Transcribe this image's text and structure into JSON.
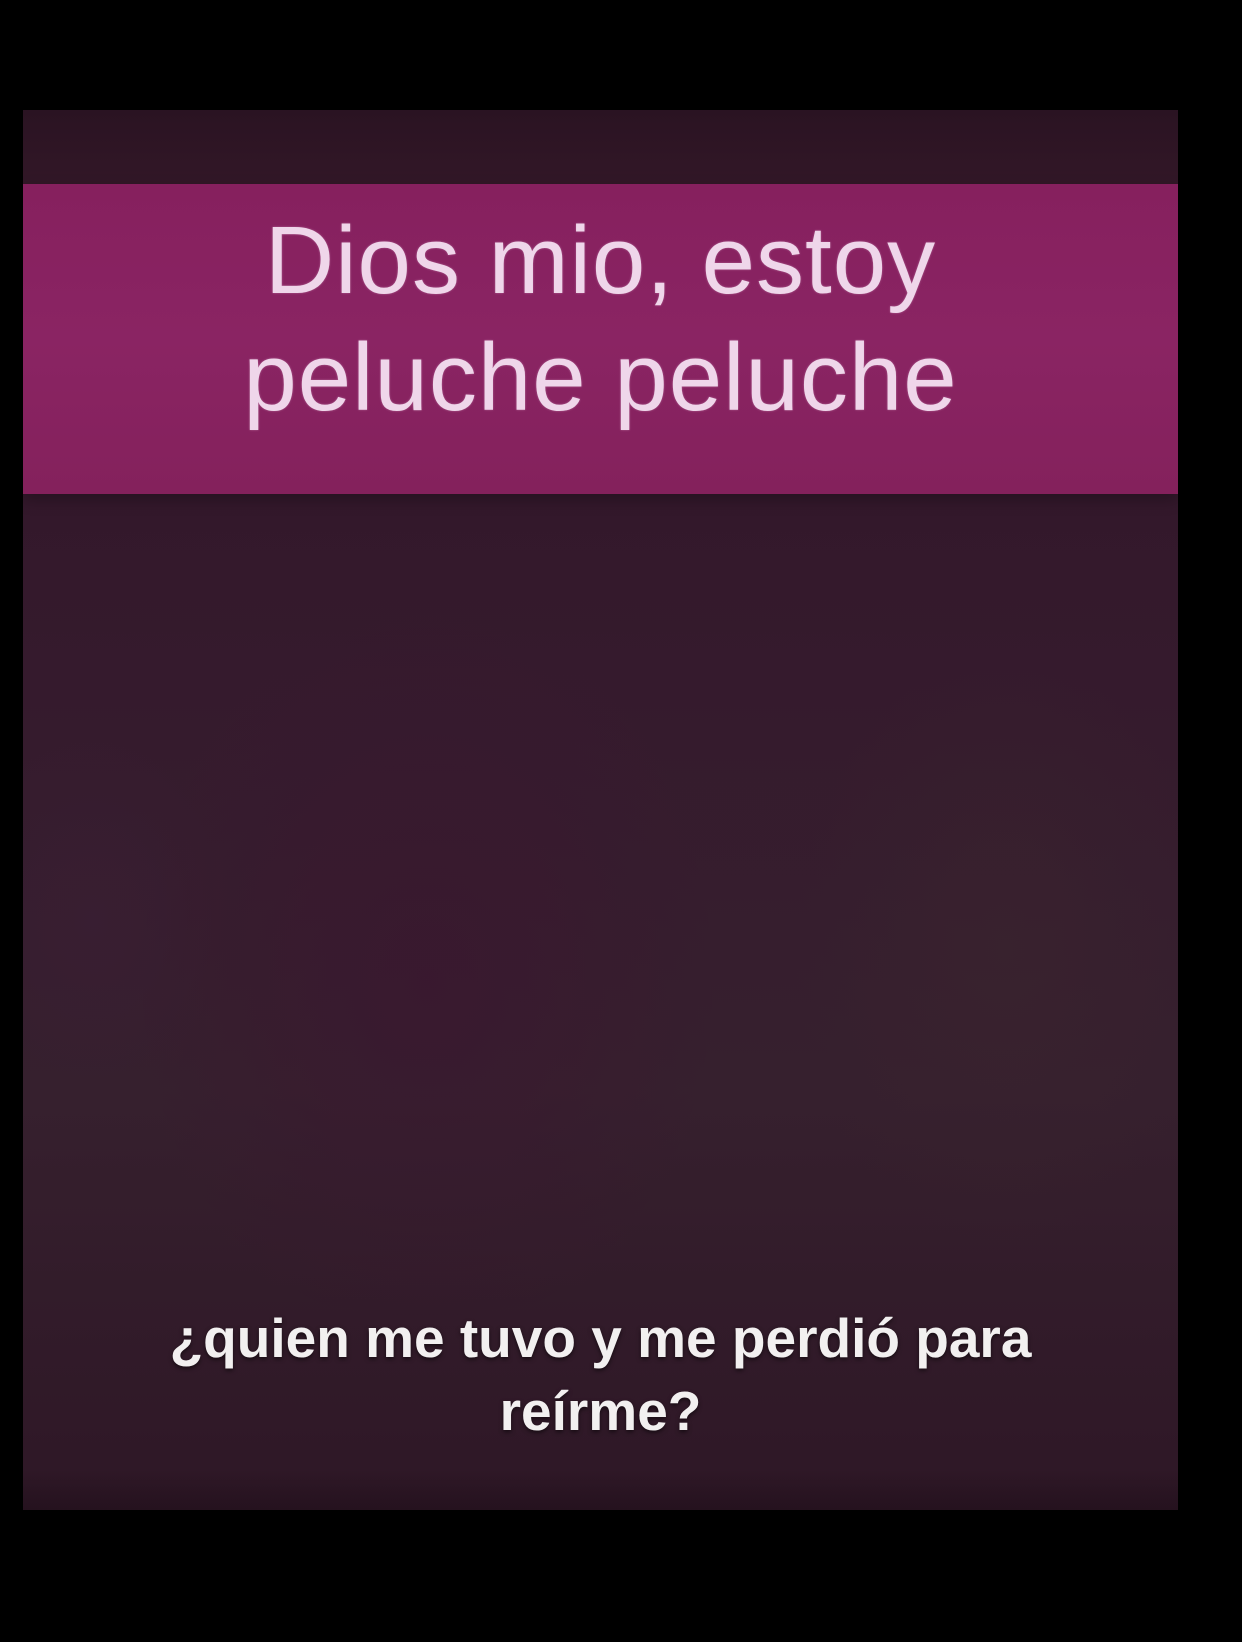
{
  "title": {
    "line1": "Dios mio, estoy",
    "line2": "peluche peluche"
  },
  "caption": {
    "line1": "¿quien me tuvo y me perdió para",
    "line2": "reírme?"
  },
  "colors": {
    "page_background": "#000000",
    "panel_background": "#36202e",
    "title_band": "#8a2463",
    "title_text": "#efd6ea",
    "caption_text": "#f2f0f0"
  }
}
